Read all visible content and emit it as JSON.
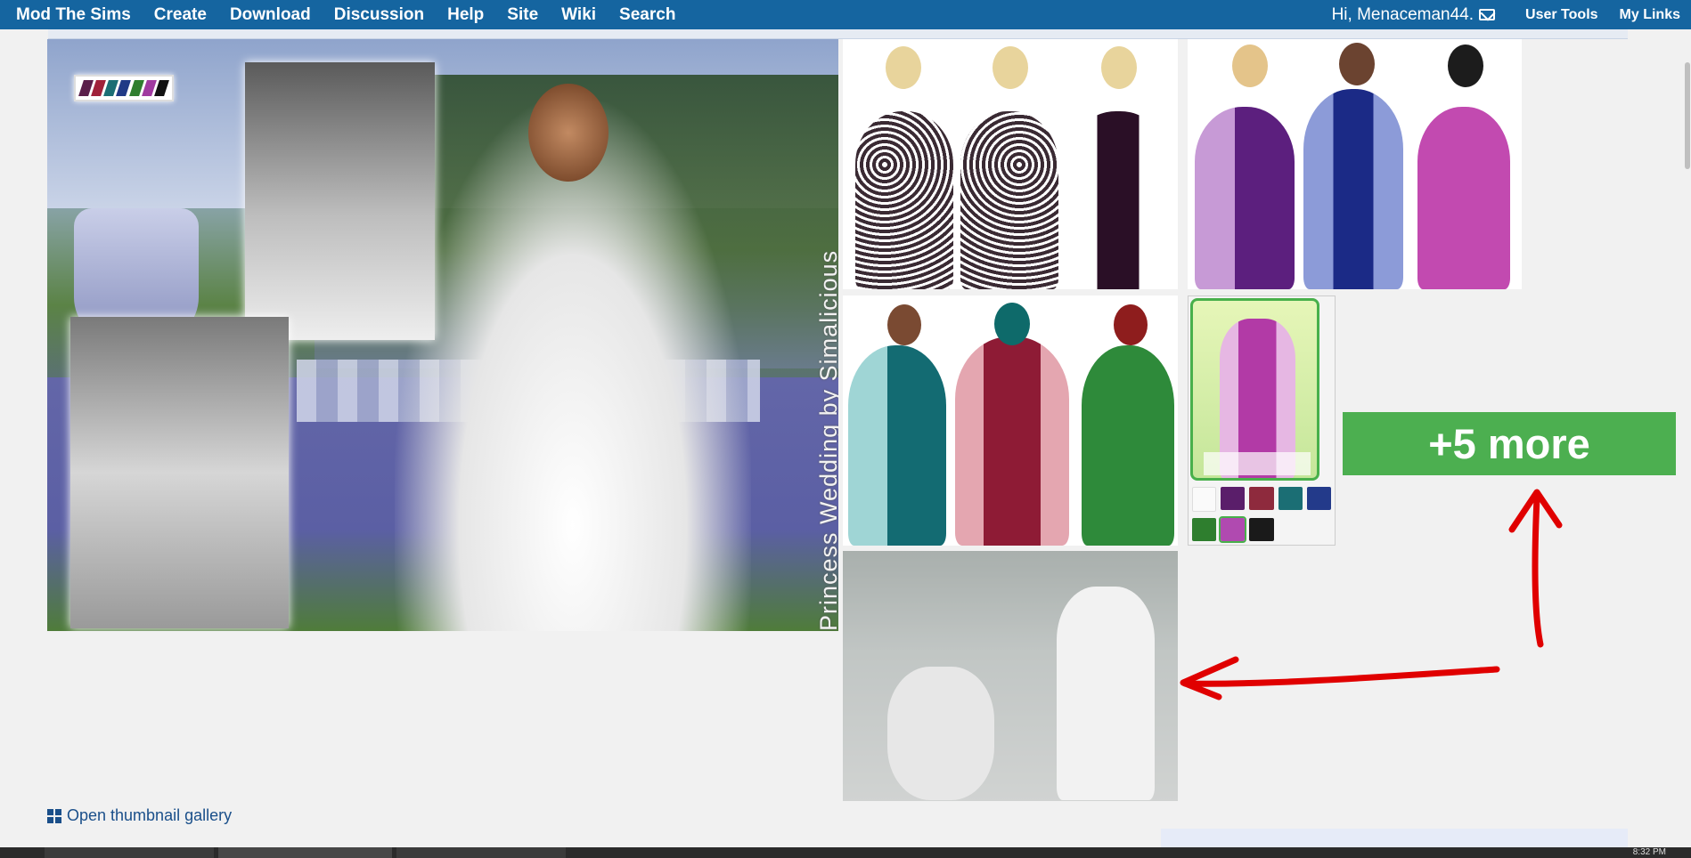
{
  "nav": {
    "brand": "Mod The Sims",
    "items": [
      "Create",
      "Download",
      "Discussion",
      "Help",
      "Site",
      "Wiki",
      "Search"
    ],
    "greeting": "Hi, Menaceman44.",
    "user_tools": "User Tools",
    "my_links": "My Links"
  },
  "gallery": {
    "watermark": "Princess Wedding by Simalicious",
    "more_label": "+5 more",
    "open_gallery_label": "Open thumbnail gallery"
  },
  "colors": {
    "nav_bg": "#1565a0",
    "more_button": "#4caf50",
    "annotation_arrow": "#e00000",
    "link": "#1a4f8a"
  },
  "taskbar": {
    "clock": "8:32 PM"
  },
  "icons": [
    "mail-icon",
    "grid-icon"
  ]
}
